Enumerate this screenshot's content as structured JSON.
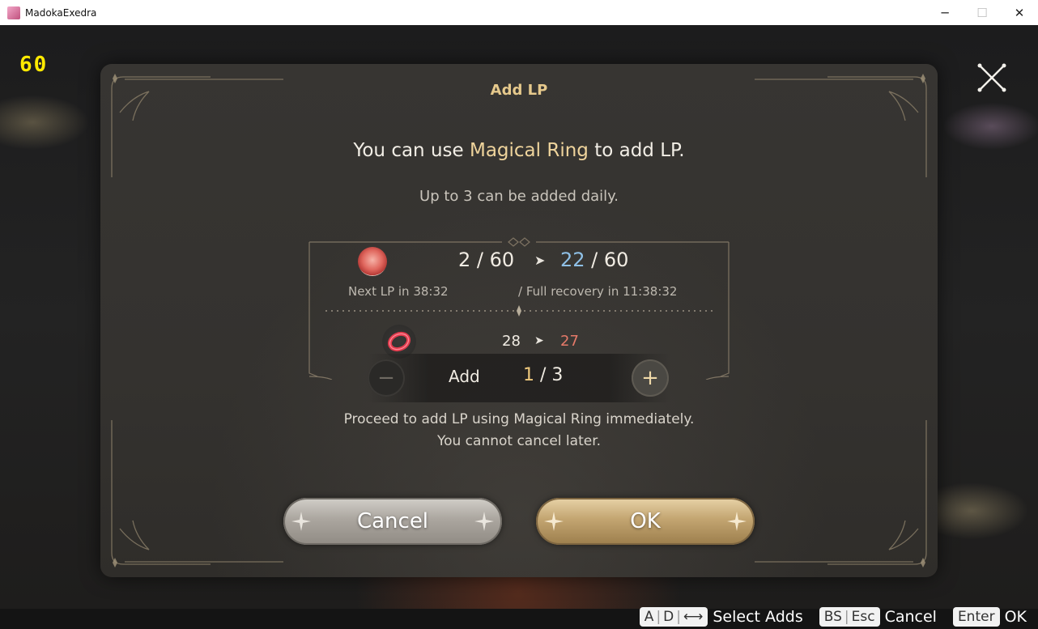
{
  "window": {
    "title": "MadokaExedra",
    "minimize": "─",
    "maximize": "☐",
    "close": "✕"
  },
  "overlay": {
    "fps": "60"
  },
  "dialog": {
    "title": "Add LP",
    "headline_prefix": "You can use ",
    "headline_item": "Magical Ring",
    "headline_suffix": " to add LP.",
    "subline": "Up to 3 can be added daily.",
    "lp": {
      "from": "2 / 60",
      "to_value": "22",
      "to_max": " / 60",
      "arrow": "➤",
      "next_lp": "Next LP in 38:32",
      "full_recovery": "/ Full recovery in 11:38:32"
    },
    "ring": {
      "from": "28",
      "to": "27",
      "arrow": "➤"
    },
    "add": {
      "label": "Add",
      "current": "1",
      "max": " / 3",
      "minus": "−",
      "plus": "+"
    },
    "proceed_line1": "Proceed to add LP using Magical Ring immediately.",
    "proceed_line2": "You cannot cancel later.",
    "cancel_label": "Cancel",
    "ok_label": "OK"
  },
  "hints": {
    "select_keys": [
      "A",
      "D",
      "⟷"
    ],
    "select_label": "Select Adds",
    "cancel_keys": [
      "BS",
      "Esc"
    ],
    "cancel_label": "Cancel",
    "ok_key": "Enter",
    "ok_label": "OK"
  },
  "colors": {
    "accent_gold": "#efd49c",
    "lp_blue": "#8fc0e6",
    "ring_red": "#e57a69"
  }
}
